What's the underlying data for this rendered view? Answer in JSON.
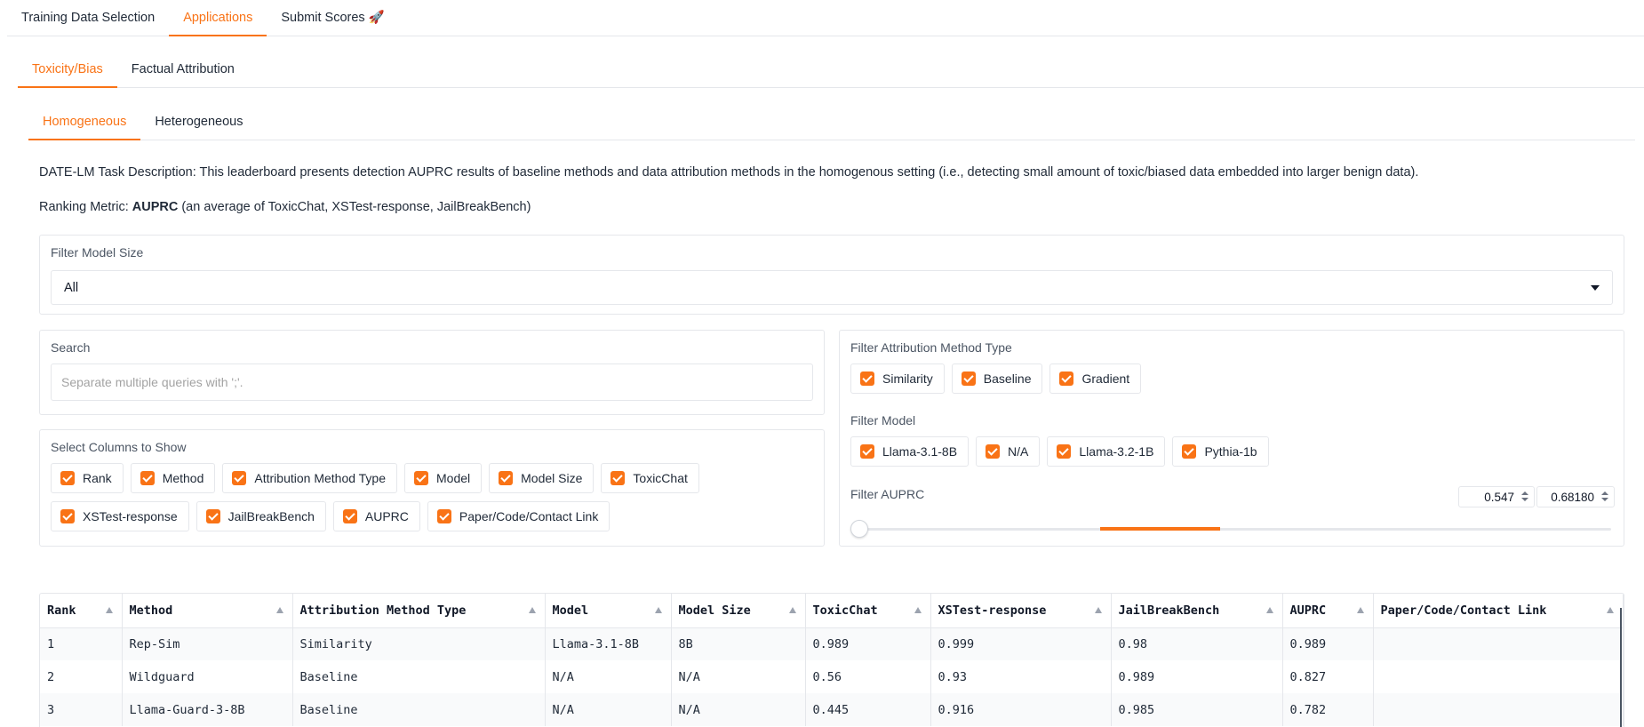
{
  "tabs_top": [
    "Training Data Selection",
    "Applications",
    "Submit Scores 🚀"
  ],
  "tabs_app": [
    "Toxicity/Bias",
    "Factual Attribution"
  ],
  "tabs_tox": [
    "Homogeneous",
    "Heterogeneous"
  ],
  "description": "DATE-LM Task Description: This leaderboard presents detection AUPRC results of baseline methods and data attribution methods in the homogenous setting (i.e., detecting small amount of toxic/biased data embedded into larger benign data).",
  "ranking": {
    "prefix": "Ranking Metric: ",
    "metric": "AUPRC",
    "suffix": " (an average of ToxicChat, XSTest-response, JailBreakBench)"
  },
  "filter_model_size": {
    "label": "Filter Model Size",
    "value": "All"
  },
  "search": {
    "label": "Search",
    "placeholder": "Separate multiple queries with ';'."
  },
  "columns": {
    "label": "Select Columns to Show",
    "row1": [
      "Rank",
      "Method",
      "Attribution Method Type",
      "Model",
      "Model Size",
      "ToxicChat"
    ],
    "row2": [
      "XSTest-response",
      "JailBreakBench",
      "AUPRC",
      "Paper/Code/Contact Link"
    ]
  },
  "filter_method_type": {
    "label": "Filter Attribution Method Type",
    "options": [
      "Similarity",
      "Baseline",
      "Gradient"
    ]
  },
  "filter_model": {
    "label": "Filter Model",
    "options": [
      "Llama-3.1-8B",
      "N/A",
      "Llama-3.2-1B",
      "Pythia-1b"
    ]
  },
  "filter_auprc": {
    "label": "Filter AUPRC",
    "min_value": "0.547",
    "max_value": "0.68180",
    "range_start": 0.32,
    "range_end": 0.48
  },
  "table": {
    "headers": [
      "Rank",
      "Method",
      "Attribution Method Type",
      "Model",
      "Model Size",
      "ToxicChat",
      "XSTest-response",
      "JailBreakBench",
      "AUPRC",
      "Paper/Code/Contact Link"
    ],
    "rows": [
      [
        "1",
        "Rep-Sim",
        "Similarity",
        "Llama-3.1-8B",
        "8B",
        "0.989",
        "0.999",
        "0.98",
        "0.989",
        ""
      ],
      [
        "2",
        "Wildguard",
        "Baseline",
        "N/A",
        "N/A",
        "0.56",
        "0.93",
        "0.989",
        "0.827",
        ""
      ],
      [
        "3",
        "Llama-Guard-3-8B",
        "Baseline",
        "N/A",
        "N/A",
        "0.445",
        "0.916",
        "0.985",
        "0.782",
        ""
      ]
    ]
  },
  "colors": {
    "accent": "#f97316",
    "border": "#e5e7eb"
  }
}
